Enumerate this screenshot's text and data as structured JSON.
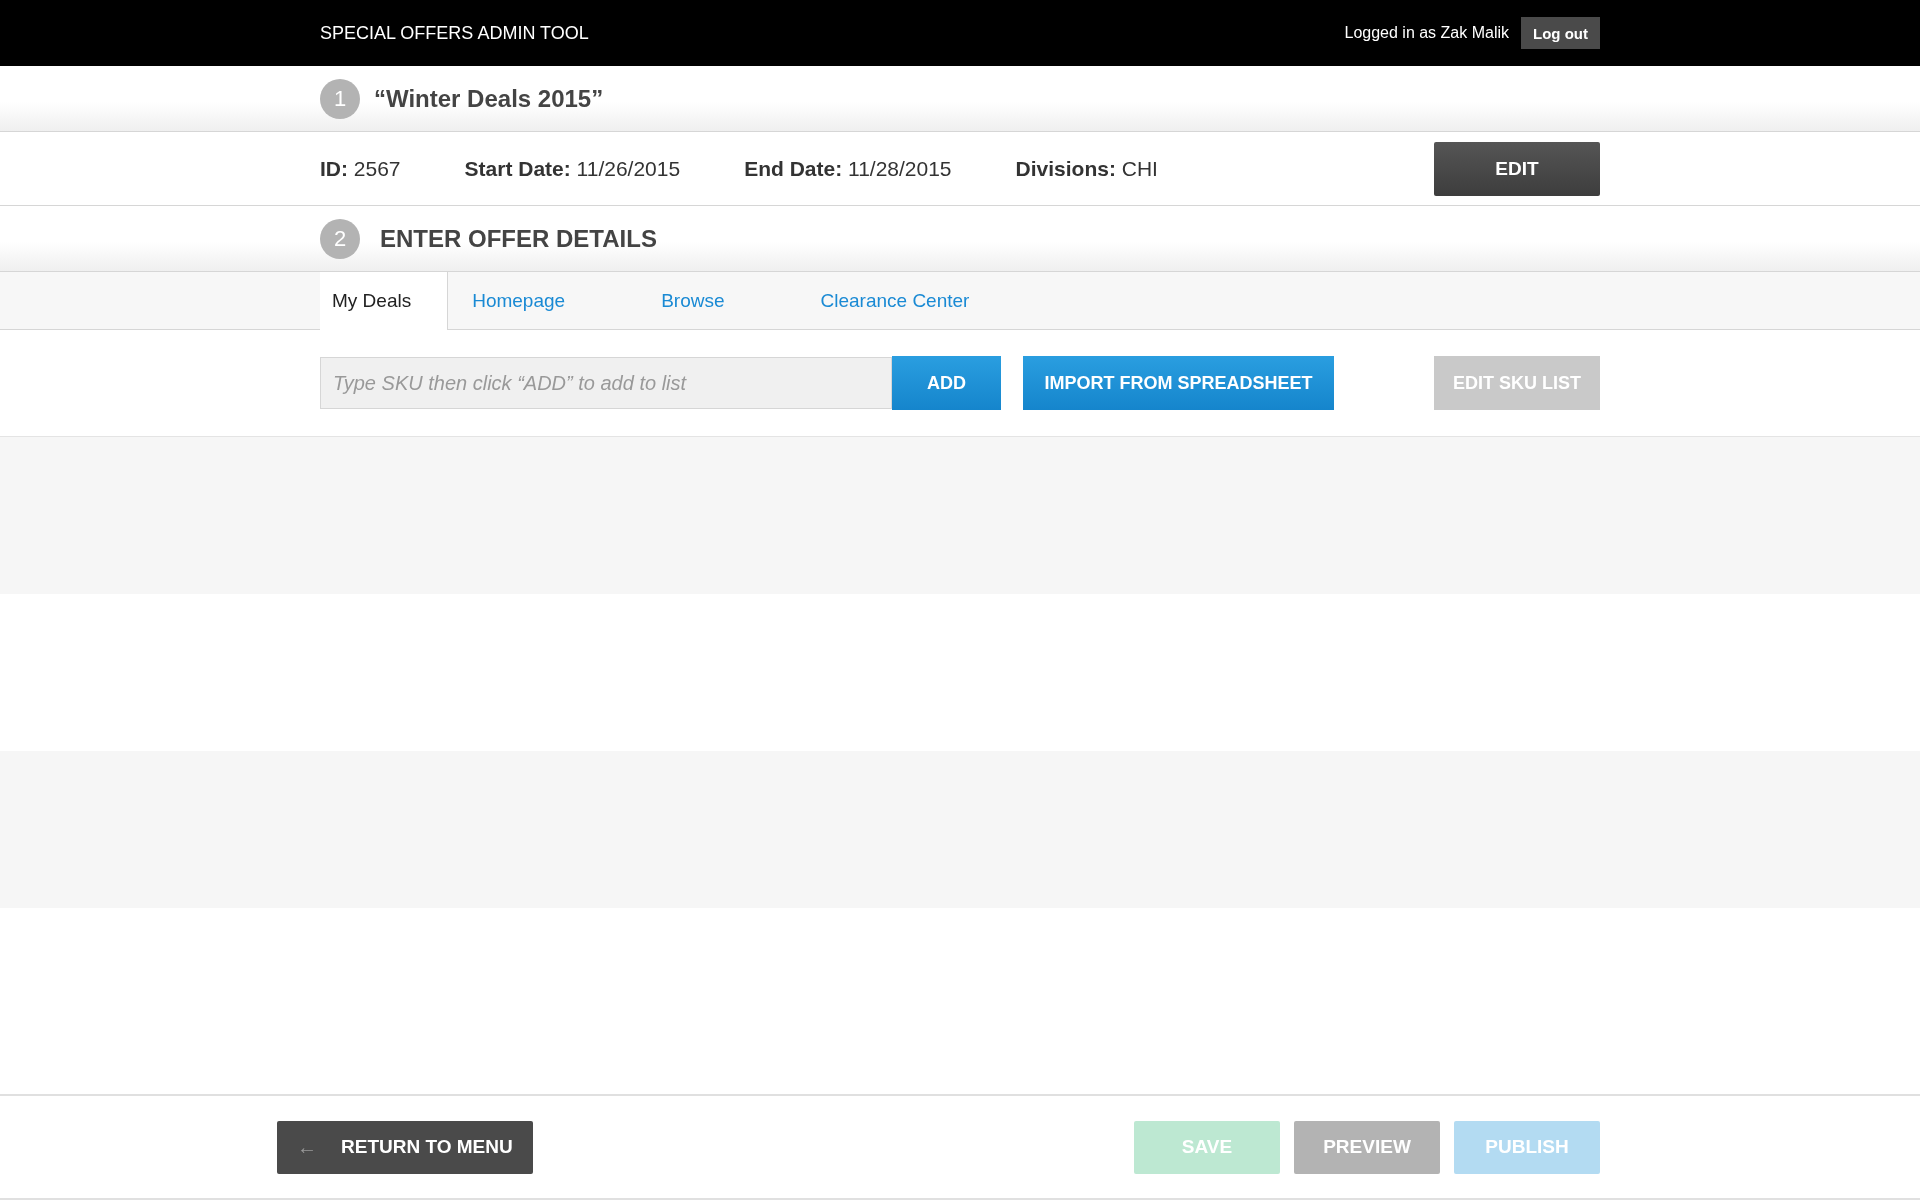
{
  "header": {
    "title": "SPECIAL OFFERS ADMIN TOOL",
    "user_text": "Logged in as Zak Malik",
    "logout": "Log out"
  },
  "steps": [
    {
      "number": "1",
      "title": "“Winter Deals 2015”"
    },
    {
      "number": "2",
      "title": "ENTER OFFER DETAILS"
    }
  ],
  "info": [
    {
      "label": "ID:",
      "value": "2567"
    },
    {
      "label": "Start Date:",
      "value": "11/26/2015"
    },
    {
      "label": "End Date:",
      "value": "11/28/2015"
    },
    {
      "label": "Divisions:",
      "value": "CHI"
    }
  ],
  "edit_button": "EDIT",
  "tabs": [
    {
      "label": "My Deals",
      "selected": true
    },
    {
      "label": "Homepage",
      "selected": false
    },
    {
      "label": "Browse",
      "selected": false
    },
    {
      "label": "Clearance Center",
      "selected": false
    }
  ],
  "sku_field": {
    "placeholder": "Type SKU then click “ADD” to add to list"
  },
  "add_button": {
    "label": "ADD",
    "disabled": false
  },
  "import_button": {
    "label": "IMPORT FROM SPREADSHEET",
    "disabled": false
  },
  "edit_sku_button": {
    "label": "EDIT SKU LIST",
    "disabled": true
  },
  "return_button": {
    "label": "RETURN TO MENU",
    "icon": "←"
  },
  "footer_buttons": [
    {
      "label": "SAVE",
      "kind": "save",
      "disabled": true
    },
    {
      "label": "PREVIEW",
      "kind": "preview",
      "disabled": true
    },
    {
      "label": "PUBLISH",
      "kind": "publish",
      "disabled": true
    }
  ]
}
